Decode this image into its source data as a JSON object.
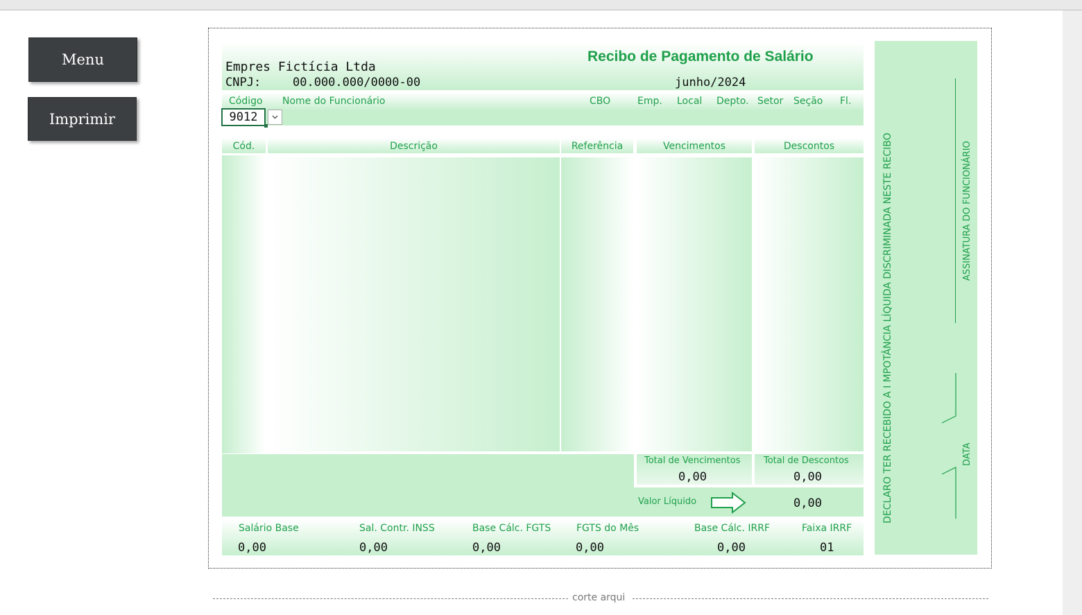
{
  "buttons": {
    "menu": "Menu",
    "print": "Imprimir"
  },
  "company": {
    "name": "Empres Fictícia Ltda",
    "cnpj_label": "CNPJ:",
    "cnpj": "00.000.000/0000-00"
  },
  "receipt": {
    "title": "Recibo de Pagamento de Salário",
    "period": "junho/2024"
  },
  "employee_header": {
    "codigo": "Código",
    "nome": "Nome do Funcionário",
    "cbo": "CBO",
    "emp": "Emp.",
    "local": "Local",
    "depto": "Depto.",
    "setor": "Setor",
    "secao": "Seção",
    "fl": "Fl.",
    "codigo_value": "9012"
  },
  "table_headers": {
    "cod": "Cód.",
    "descricao": "Descrição",
    "referencia": "Referência",
    "vencimentos": "Vencimentos",
    "descontos": "Descontos"
  },
  "totals": {
    "vencimentos_label": "Total de Vencimentos",
    "vencimentos": "0,00",
    "descontos_label": "Total de Descontos",
    "descontos": "0,00",
    "liquido_label": "Valor Líquido",
    "liquido": "0,00"
  },
  "bases": {
    "salario_base_label": "Salário Base",
    "salario_base": "0,00",
    "inss_label": "Sal. Contr. INSS",
    "inss": "0,00",
    "fgts_label": "Base Cálc. FGTS",
    "fgts": "0,00",
    "fgts_mes_label": "FGTS do Mês",
    "fgts_mes": "0,00",
    "irrf_label": "Base Cálc. IRRF",
    "irrf": "0,00",
    "faixa_label": "Faixa IRRF",
    "faixa": "01"
  },
  "side": {
    "declaracao": "DECLARO TER RECEBIDO  A I MPOTÂNCIA LÍQUIDA DISCRIMINADA NESTE RECIBO",
    "assinatura": "ASSINATURA DO FUNCIONÁRIO",
    "data": "DATA"
  },
  "cut_label": "corte arqui",
  "colors": {
    "accent": "#1fa04b",
    "fill": "#c6efce",
    "button": "#3c3f41"
  },
  "icons": {
    "dropdown": "chevron-down-icon",
    "arrow": "arrow-right-icon"
  }
}
